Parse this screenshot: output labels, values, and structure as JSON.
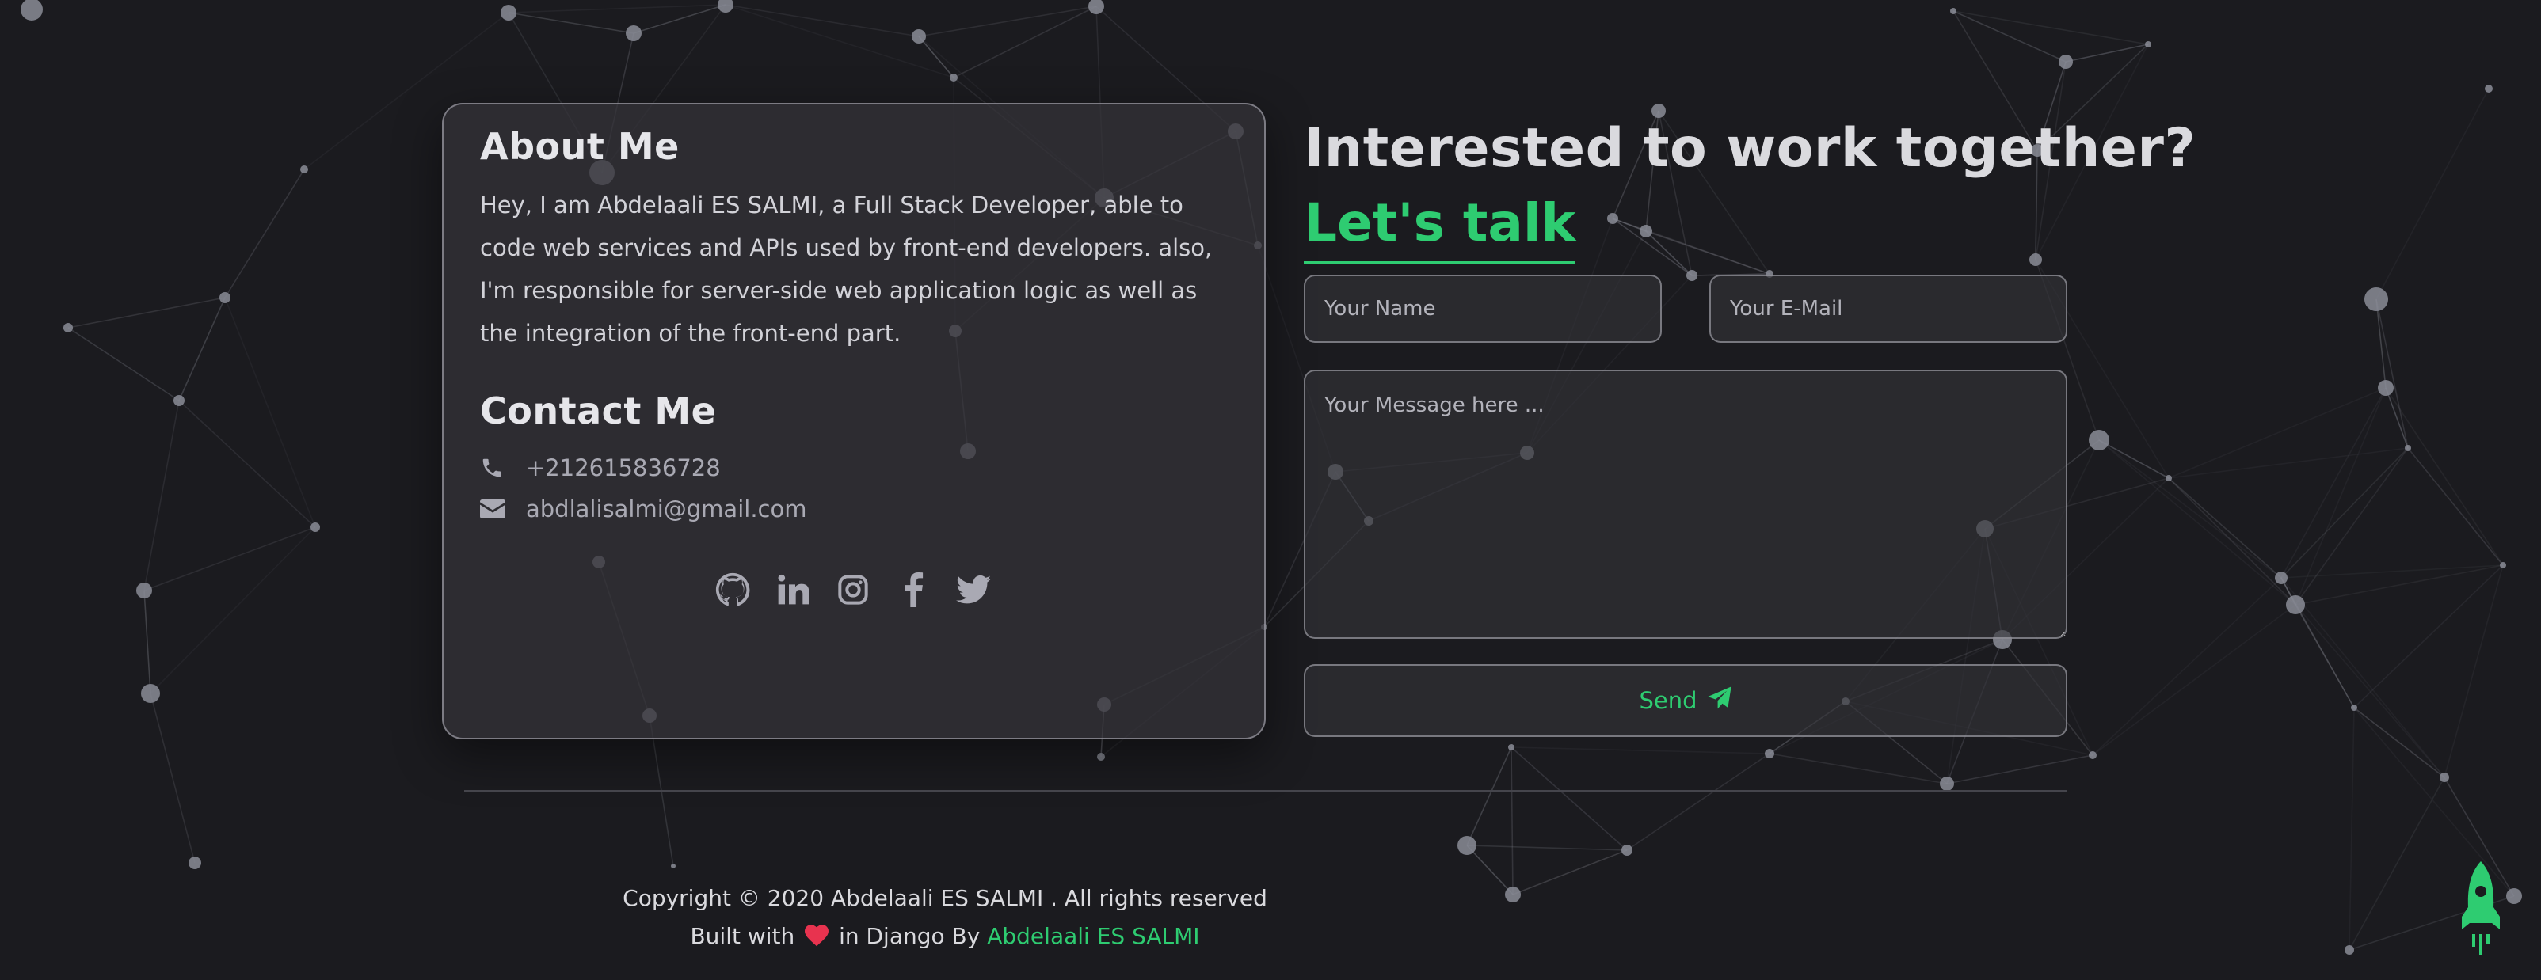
{
  "about": {
    "heading": "About Me",
    "text": "Hey, I am Abdelaali ES SALMI, a Full Stack Developer, able to code web services and APIs used by front-end developers. also, I'm responsible for server-side web application logic as well as the integration of the front-end part."
  },
  "contact": {
    "heading": "Contact Me",
    "phone": "+212615836728",
    "email": "abdlalisalmi@gmail.com",
    "phone_icon": "phone-icon",
    "email_icon": "envelope-icon"
  },
  "socials": [
    {
      "icon": "github-icon"
    },
    {
      "icon": "linkedin-icon"
    },
    {
      "icon": "instagram-icon"
    },
    {
      "icon": "facebook-icon"
    },
    {
      "icon": "twitter-icon"
    }
  ],
  "form": {
    "title": "Interested to work together?",
    "subtitle": "Let's talk",
    "name_placeholder": "Your Name",
    "email_placeholder": "Your E-Mail",
    "message_placeholder": "Your Message here ...",
    "send_label": "Send",
    "send_icon": "paper-plane-icon"
  },
  "footer": {
    "copyright": "Copyright © 2020 Abdelaali ES SALMI . All rights reserved",
    "built_prefix": "Built with",
    "built_middle": "in Django By",
    "author": "Abdelaali ES SALMI",
    "heart_icon": "heart-icon"
  },
  "scroll_top_icon": "rocket-icon",
  "colors": {
    "background": "#1b1b1f",
    "accent": "#2ecc71",
    "heart": "#e8334f",
    "particle": "#8a8c96"
  }
}
